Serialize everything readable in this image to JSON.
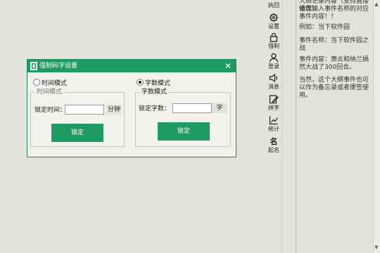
{
  "info_panel": {
    "lines": [
      "大纲记录内容（支持直接修改）",
      "请您输入事件名称的对应事件内容！！",
      "例如：当下软件园",
      "事件名称：当下软件园之战",
      "事件内容：萧炎和纳兰嫣然大战了300回合。",
      "当然，这个大纲事件也可以作为备忘录或者便签使用。"
    ]
  },
  "toolbar": {
    "return_label": "执回",
    "settings_label": "设置",
    "force_label": "强制",
    "login_label": "登录",
    "message_label": "消息",
    "typing_label": "拼字",
    "stats_label": "统计",
    "naming_glyph": "名",
    "naming_label": "起名"
  },
  "dialog": {
    "title": "强制码字设置",
    "close_symbol": "✕",
    "time_mode_label": "时间模式",
    "word_mode_label": "字数模式",
    "time_group_title": "时间模式",
    "word_group_title": "字数模式",
    "lock_time_label": "锁定时间：",
    "lock_time_value": "",
    "time_unit": "分钟",
    "lock_words_label": "锁定字数：",
    "lock_words_value": "",
    "word_unit": "字",
    "lock_button_label": "锁定",
    "selected_mode": "word"
  },
  "colors": {
    "accent": "#1e9a63",
    "background": "#e4e2dd"
  }
}
